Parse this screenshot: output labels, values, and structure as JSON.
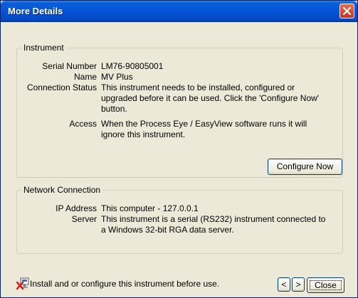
{
  "window": {
    "title": "More Details"
  },
  "instrument": {
    "legend": "Instrument",
    "fields": [
      {
        "label": "Serial Number",
        "value": "LM76-90805001"
      },
      {
        "label": "Name",
        "value": "MV Plus"
      },
      {
        "label": "Connection Status",
        "value": "This instrument needs to be installed, configured or upgraded before it can be used.  Click the 'Configure Now' button."
      },
      {
        "label": "Access",
        "value": "When the Process Eye / EasyView software runs it will ignore this instrument."
      }
    ],
    "configure_button": "Configure Now"
  },
  "network": {
    "legend": "Network Connection",
    "fields": [
      {
        "label": "IP Address",
        "value": "This computer - 127.0.0.1"
      },
      {
        "label": "Server",
        "value": "This instrument is a serial (RS232) instrument connected to a Windows 32-bit RGA data server."
      }
    ]
  },
  "footer": {
    "message": "Install and or configure this instrument before use.",
    "prev_label": "<",
    "next_label": ">",
    "close_label": "Close",
    "icon": "warning-x-icon"
  },
  "colors": {
    "titlebar": "#0453d6",
    "dialog_bg": "#ece9d8",
    "close_button": "#c2352b"
  }
}
